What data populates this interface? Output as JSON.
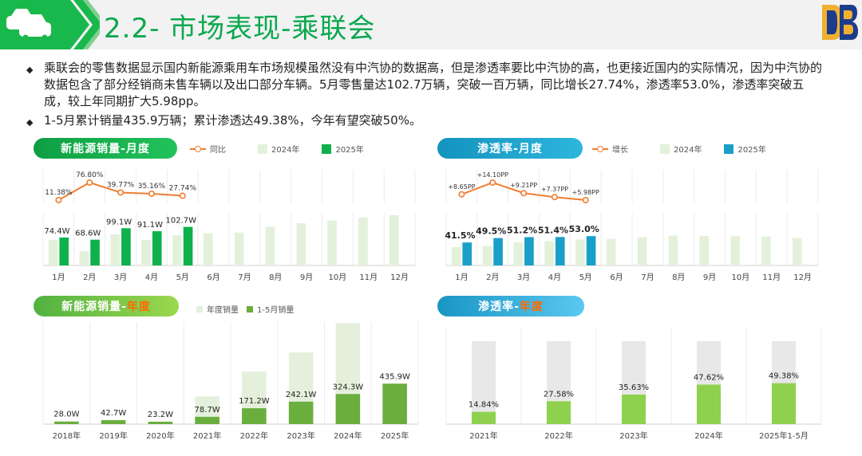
{
  "header": {
    "title": "2.2- 市场表现-乘联会"
  },
  "intro": {
    "bullets": [
      "乘联会的零售数据显示国内新能源乘用车市场规模虽然没有中汽协的数据高，但是渗透率要比中汽协的高，也更接近国内的实际情况，因为中汽协的数据包含了部分经销商未售车辆以及出口部分车辆。5月零售量达102.7万辆，突破一百万辆，同比增长27.74%，渗透率53.0%，渗透率突破五成，较上年同期扩大5.98pp。",
      "1-5月累计销量435.9万辆；累计渗透达49.38%，今年有望突破50%。"
    ]
  },
  "colors": {
    "green_title": "#0aa84f",
    "green_dark": "#0fb14d",
    "green_light": "#e3f1db",
    "teal": "#1a9fc8",
    "teal_light": "#e3f1db",
    "orange": "#f07d32",
    "annual_dark": "#6aae3e",
    "annual_light": "#e4f0dc",
    "pen_green": "#8fd14f",
    "pen_gray": "#e8e8e8"
  },
  "panels": {
    "monthly_sales": {
      "pill_label": "新能源销量-月度",
      "legend": [
        "同比",
        "2024年",
        "2025年"
      ]
    },
    "monthly_pen": {
      "pill_label": "渗透率-月度",
      "legend": [
        "增长",
        "2024年",
        "2025年"
      ]
    },
    "annual_sales": {
      "pill_prefix": "新能源销量-",
      "pill_accent": "年度",
      "legend": [
        "年度销量",
        "1-5月销量"
      ]
    },
    "annual_pen": {
      "pill_prefix": "渗透率-",
      "pill_accent": "年度"
    }
  },
  "chart_data": [
    {
      "id": "monthly_sales",
      "type": "bar",
      "categories": [
        "1月",
        "2月",
        "3月",
        "4月",
        "5月",
        "6月",
        "7月",
        "8月",
        "9月",
        "10月",
        "11月",
        "12月"
      ],
      "series": [
        {
          "name": "2024年",
          "values": [
            67.5,
            38.8,
            83.0,
            68.0,
            80.4,
            85.6,
            87.8,
            102.7,
            112.3,
            119.6,
            127.8,
            134.0
          ]
        },
        {
          "name": "2025年",
          "values": [
            74.4,
            68.6,
            99.1,
            91.1,
            102.7
          ],
          "labels": [
            "74.4W",
            "68.6W",
            "99.1W",
            "91.1W",
            "102.7W"
          ]
        }
      ],
      "line": {
        "name": "同比",
        "values": [
          11.38,
          76.8,
          39.77,
          35.16,
          27.74
        ],
        "labels": [
          "11.38%",
          "76.80%",
          "39.77%",
          "35.16%",
          "27.74%"
        ]
      }
    },
    {
      "id": "monthly_pen",
      "type": "bar",
      "categories": [
        "1月",
        "2月",
        "3月",
        "4月",
        "5月",
        "6月",
        "7月",
        "8月",
        "9月",
        "10月",
        "11月",
        "12月"
      ],
      "series": [
        {
          "name": "2024年",
          "values": [
            32.9,
            35.4,
            42.0,
            44.0,
            47.0,
            48.0,
            51.1,
            53.9,
            53.3,
            52.9,
            52.3,
            49.5
          ]
        },
        {
          "name": "2025年",
          "values": [
            41.5,
            49.5,
            51.2,
            51.4,
            53.0
          ],
          "labels": [
            "41.5%",
            "49.5%",
            "51.2%",
            "51.4%",
            "53.0%"
          ]
        }
      ],
      "line": {
        "name": "增长",
        "values": [
          8.65,
          14.1,
          9.21,
          7.37,
          5.98
        ],
        "labels": [
          "+8.65PP",
          "+14.10PP",
          "+9.21PP",
          "+7.37PP",
          "+5.98PP"
        ]
      }
    },
    {
      "id": "annual_sales",
      "type": "bar",
      "categories": [
        "2018年",
        "2019年",
        "2020年",
        "2021年",
        "2022年",
        "2023年",
        "2024年",
        "2025年"
      ],
      "series": [
        {
          "name": "年度销量",
          "values": [
            null,
            null,
            null,
            298.9,
            567.4,
            773.6,
            1089.9,
            null
          ]
        },
        {
          "name": "1-5月销量",
          "values": [
            28.0,
            42.7,
            23.2,
            78.7,
            171.2,
            242.1,
            324.3,
            435.9
          ],
          "labels": [
            "28.0W",
            "42.7W",
            "23.2W",
            "78.7W",
            "171.2W",
            "242.1W",
            "324.3W",
            "435.9W"
          ]
        }
      ]
    },
    {
      "id": "annual_pen",
      "type": "bar",
      "categories": [
        "2021年",
        "2022年",
        "2023年",
        "2024年",
        "2025年1-5月"
      ],
      "series": [
        {
          "values": [
            14.84,
            27.58,
            35.63,
            47.62,
            49.38
          ],
          "labels": [
            "14.84%",
            "27.58%",
            "35.63%",
            "47.62%",
            "49.38%"
          ]
        }
      ]
    }
  ]
}
